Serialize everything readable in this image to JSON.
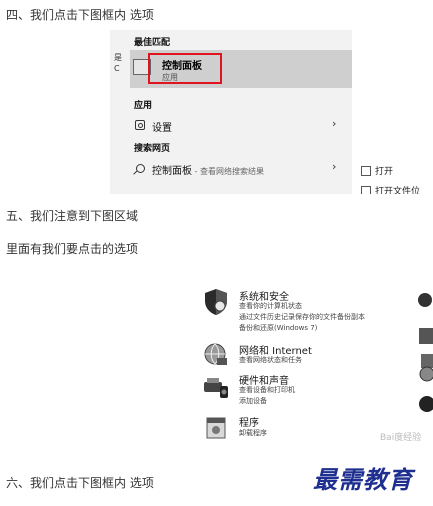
{
  "steps": {
    "step4": "四、我们点击下图框内 选项",
    "step5": "五、我们注意到下图区域",
    "step5_note": "里面有我们要点击的选项",
    "step6": "六、我们点击下图框内 选项"
  },
  "search_panel": {
    "best_match_header": "最佳匹配",
    "best_match_title": "控制面板",
    "best_match_subtitle": "应用",
    "apps_header": "应用",
    "settings_label": "设置",
    "web_header": "搜索网页",
    "web_query": "控制面板",
    "web_query_suffix": " - 查看网络搜索结果",
    "right_open": "打开",
    "right_open_location": "打开文件位",
    "left_edge_1": "是",
    "left_edge_2": "C"
  },
  "control_panel": {
    "system_security": {
      "title": "系统和安全",
      "lines": [
        "查看你的计算机状态",
        "通过文件历史记录保存你的文件备份副本",
        "备份和还原(Windows 7)"
      ]
    },
    "network": {
      "title": "网络和 Internet",
      "lines": [
        "查看网络状态和任务"
      ]
    },
    "hardware": {
      "title": "硬件和声音",
      "lines": [
        "查看设备和打印机",
        "添加设备"
      ]
    },
    "programs": {
      "title": "程序",
      "lines": [
        "卸载程序"
      ]
    },
    "watermark": "Bai度经验"
  },
  "logo_text": "最需教育",
  "colors": {
    "highlight_box": "#e0141e",
    "logo": "#1f2f8f"
  }
}
